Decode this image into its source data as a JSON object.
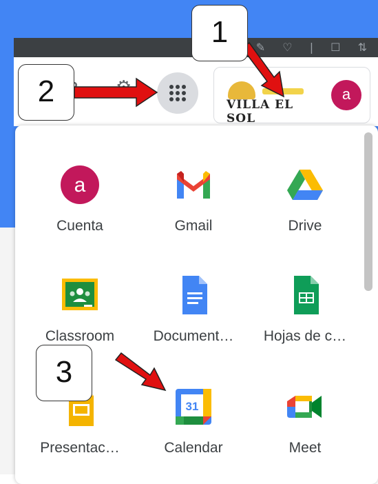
{
  "header": {
    "logo_text": "VILLA EL SOL",
    "avatar_letter": "a"
  },
  "apps": [
    {
      "label": "Cuenta",
      "icon": "account-icon"
    },
    {
      "label": "Gmail",
      "icon": "gmail-icon"
    },
    {
      "label": "Drive",
      "icon": "drive-icon"
    },
    {
      "label": "Classroom",
      "icon": "classroom-icon"
    },
    {
      "label": "Document…",
      "icon": "docs-icon"
    },
    {
      "label": "Hojas de c…",
      "icon": "sheets-icon"
    },
    {
      "label": "Presentac…",
      "icon": "slides-icon"
    },
    {
      "label": "Calendar",
      "icon": "calendar-icon",
      "icon_text": "31"
    },
    {
      "label": "Meet",
      "icon": "meet-icon"
    }
  ],
  "callouts": [
    {
      "label": "1"
    },
    {
      "label": "2"
    },
    {
      "label": "3"
    }
  ],
  "colors": {
    "background_blue": "#4285f4",
    "avatar": "#c2185b",
    "arrow_red": "#e01010"
  }
}
